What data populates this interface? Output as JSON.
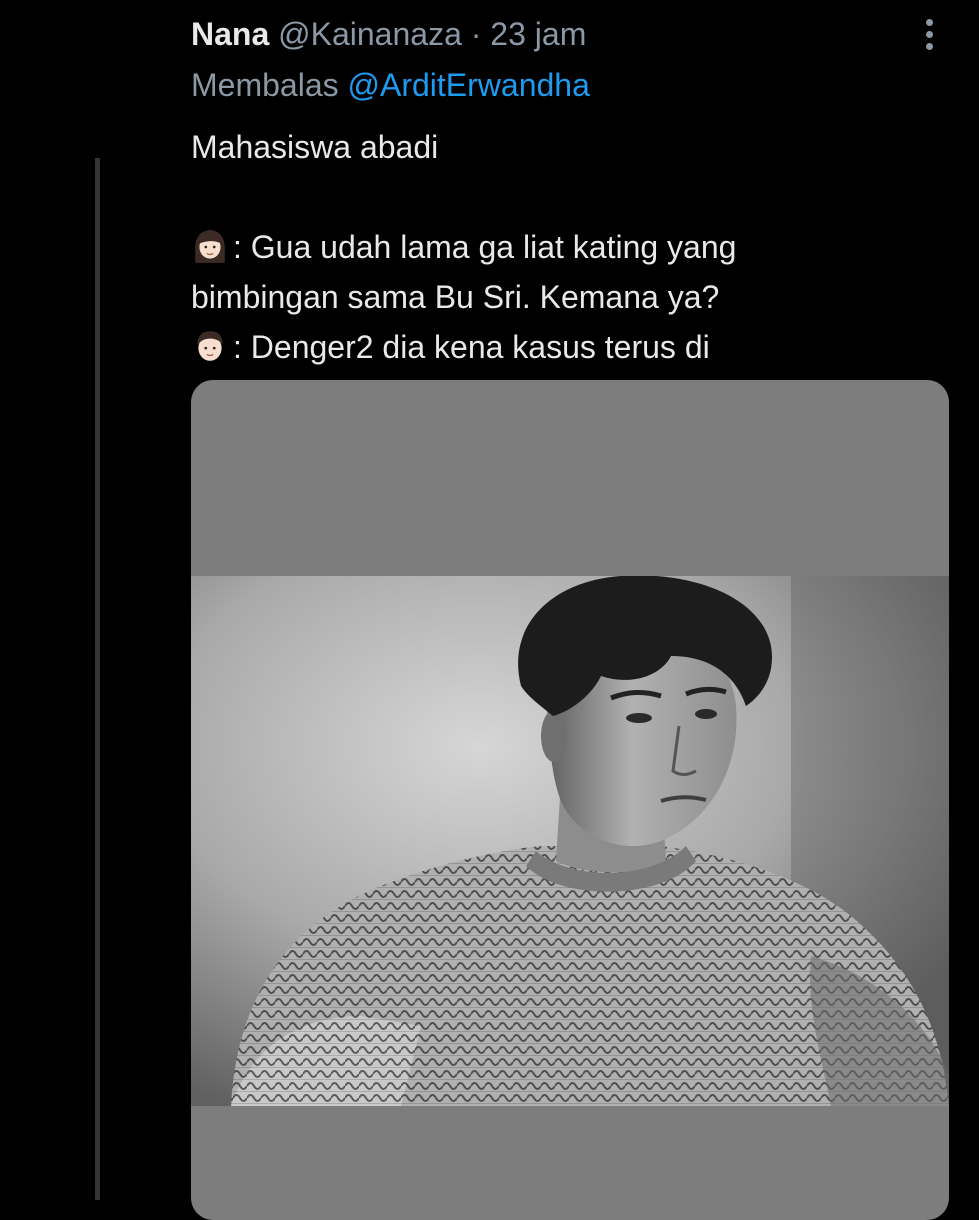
{
  "tweet": {
    "display_name": "Nana",
    "handle": "@Kainanaza",
    "separator": "·",
    "time": "23 jam",
    "reply_prefix": "Membalas",
    "reply_to": "@ArditErwandha",
    "lines": [
      "Mahasiswa abadi",
      ": Gua udah lama ga liat kating yang",
      "bimbingan sama Bu Sri. Kemana ya?",
      ": Denger2 dia kena kasus terus di"
    ],
    "icons": {
      "more": "more-vertical-icon",
      "emoji_1": "woman-emoji-icon",
      "emoji_2": "man-emoji-icon"
    },
    "colors": {
      "background": "#000000",
      "text": "#e7e9ea",
      "secondary": "#8b98a5",
      "link": "#1d9bf0",
      "thread_line": "#333639",
      "media_bg": "#7d7d7d"
    }
  }
}
